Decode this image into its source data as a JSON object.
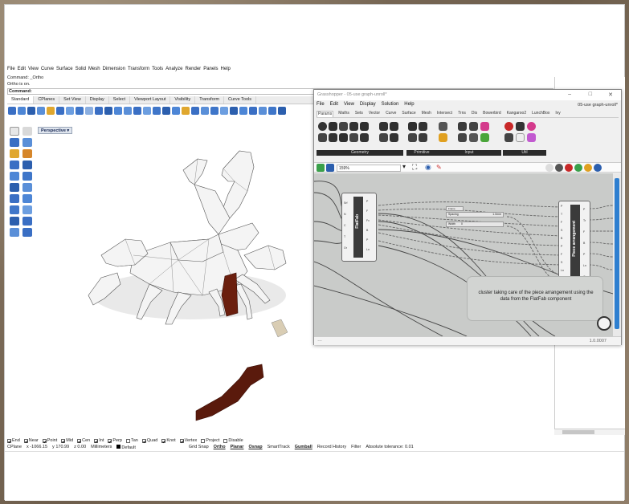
{
  "rhino": {
    "menu": [
      "File",
      "Edit",
      "View",
      "Curve",
      "Surface",
      "Solid",
      "Mesh",
      "Dimension",
      "Transform",
      "Tools",
      "Analyze",
      "Render",
      "Panels",
      "Help"
    ],
    "command_history": [
      "Command: _Ortho",
      "Ortho is on."
    ],
    "command_label": "Command:",
    "toolbar_tabs": [
      "Standard",
      "CPlanes",
      "Set View",
      "Display",
      "Select",
      "Viewport Layout",
      "Visibility",
      "Transform",
      "Curve Tools"
    ],
    "viewport_label": "Perspective",
    "osnaps": [
      {
        "label": "End",
        "checked": true
      },
      {
        "label": "Near",
        "checked": true
      },
      {
        "label": "Point",
        "checked": true
      },
      {
        "label": "Mid",
        "checked": true
      },
      {
        "label": "Cen",
        "checked": true
      },
      {
        "label": "Int",
        "checked": true
      },
      {
        "label": "Perp",
        "checked": true
      },
      {
        "label": "Tan",
        "checked": false
      },
      {
        "label": "Quad",
        "checked": true
      },
      {
        "label": "Knot",
        "checked": true
      },
      {
        "label": "Vertex",
        "checked": true
      },
      {
        "label": "Project",
        "checked": false
      },
      {
        "label": "Disable",
        "checked": false
      }
    ],
    "status": {
      "cplane": "CPlane",
      "x": "x -1066.15",
      "y": "y 170.99",
      "z": "z 0.00",
      "units": "Millimeters",
      "layer": "Default",
      "grid_snap": "Grid Snap",
      "ortho": "Ortho",
      "planar": "Planar",
      "osnap": "Osnap",
      "smarttrack": "SmartTrack",
      "gumball": "Gumball",
      "record_history": "Record History",
      "filter": "Filter",
      "tolerance": "Absolute tolerance: 0.01"
    }
  },
  "grasshopper": {
    "window_title": "Grasshopper - 05-use graph-unroll*",
    "file_title": "05-use graph-unroll*",
    "menu": [
      "File",
      "Edit",
      "View",
      "Display",
      "Solution",
      "Help"
    ],
    "tabs": [
      "Params",
      "Maths",
      "Sets",
      "Vector",
      "Curve",
      "Surface",
      "Mesh",
      "Intersect",
      "Trns",
      "Dis",
      "Bowerbird",
      "Kangaroo2",
      "LunchBox",
      "Ivy"
    ],
    "ribbon_groups": [
      "Geometry",
      "Primitive",
      "Input",
      "Util"
    ],
    "zoom": "159%",
    "nodes": {
      "flatfab_title": "FlatFab",
      "flatfab_inputs": [
        "Srf",
        "N",
        "C",
        "T",
        "Or"
      ],
      "flatfab_outputs": [
        "P",
        "F",
        "Fv",
        "B",
        "P",
        "Ln"
      ],
      "arrangement_title": "Piece arrangement",
      "arrangement_inputs": [
        "P",
        "T",
        "F",
        "S",
        "B",
        "P",
        "F",
        "S",
        "Ln",
        "Or"
      ],
      "arrangement_outputs": [
        "P",
        "Tr",
        "F",
        "B",
        "P",
        "Ln",
        "Or"
      ],
      "slider1_label": "Spacing",
      "slider1_value": "1.0mm",
      "slider2_label": "Width",
      "slider2_value": "0",
      "panel_label": "Frame"
    },
    "comment": "cluster taking care of the piece arrangement using the data from the FlatFab component",
    "version": "1.0.0007"
  }
}
